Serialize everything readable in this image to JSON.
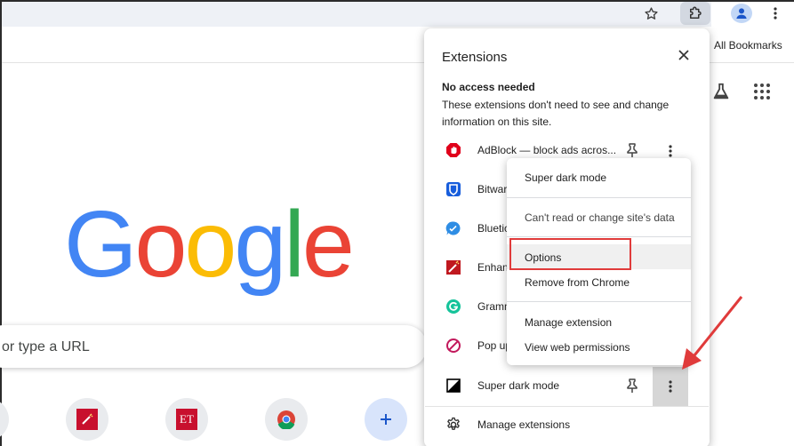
{
  "browser": {
    "all_bookmarks": "All Bookmarks",
    "search_placeholder": "or type a URL",
    "google_logo": {
      "letters": [
        "G",
        "o",
        "o",
        "g",
        "l",
        "e"
      ],
      "colors": [
        "#4285F4",
        "#EA4335",
        "#FBBC05",
        "#4285F4",
        "#34A853",
        "#EA4335"
      ]
    }
  },
  "extensions_panel": {
    "title": "Extensions",
    "close_icon": "close-icon",
    "section_heading": "No access needed",
    "section_description": "These extensions don't need to see and change information on this site.",
    "items": [
      {
        "label": "AdBlock — block ads acros...",
        "icon": "adblock-icon",
        "color": "#e0001b"
      },
      {
        "label": "Bitwar",
        "icon": "bitwarden-icon",
        "color": "#175ddc"
      },
      {
        "label": "Bluetic",
        "icon": "bluetick-icon",
        "color": "#2f8de4"
      },
      {
        "label": "Enhan",
        "icon": "enhancer-icon",
        "color": "#c0181f"
      },
      {
        "label": "Gramm",
        "icon": "grammarly-icon",
        "color": "#15c39a"
      },
      {
        "label": "Pop up",
        "icon": "popup-blocker-icon",
        "color": "#c2185b"
      },
      {
        "label": "Super dark mode",
        "icon": "super-dark-mode-icon",
        "color": "#000000"
      }
    ],
    "manage_label": "Manage extensions"
  },
  "context_menu": {
    "title_item": "Super dark mode",
    "site_access": "Can't read or change site's data",
    "options": "Options",
    "remove": "Remove from Chrome",
    "manage": "Manage extension",
    "permissions": "View web permissions"
  },
  "annotation": {
    "highlight_color": "#e03b3b"
  }
}
